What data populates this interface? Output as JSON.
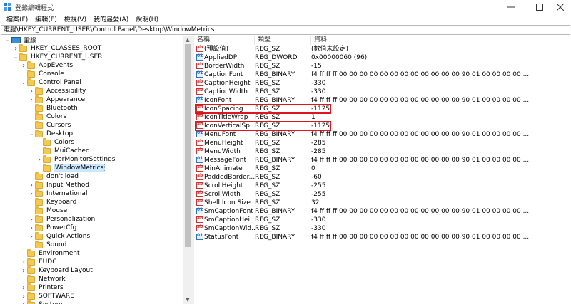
{
  "window": {
    "title": "登錄編輯程式"
  },
  "menu": [
    "檔案(F)",
    "編輯(E)",
    "檢視(V)",
    "我的最愛(A)",
    "說明(H)"
  ],
  "address": "電腦\\HKEY_CURRENT_USER\\Control Panel\\Desktop\\WindowMetrics",
  "tree": [
    {
      "label": "電腦",
      "level": 0,
      "expanded": true,
      "kind": "computer"
    },
    {
      "label": "HKEY_CLASSES_ROOT",
      "level": 1,
      "expanded": false
    },
    {
      "label": "HKEY_CURRENT_USER",
      "level": 1,
      "expanded": true
    },
    {
      "label": "AppEvents",
      "level": 2,
      "expanded": false
    },
    {
      "label": "Console",
      "level": 2,
      "expanded": null
    },
    {
      "label": "Control Panel",
      "level": 2,
      "expanded": true
    },
    {
      "label": "Accessibility",
      "level": 3,
      "expanded": false
    },
    {
      "label": "Appearance",
      "level": 3,
      "expanded": false
    },
    {
      "label": "Bluetooth",
      "level": 3,
      "expanded": null
    },
    {
      "label": "Colors",
      "level": 3,
      "expanded": null
    },
    {
      "label": "Cursors",
      "level": 3,
      "expanded": null
    },
    {
      "label": "Desktop",
      "level": 3,
      "expanded": true
    },
    {
      "label": "Colors",
      "level": 4,
      "expanded": null
    },
    {
      "label": "MuiCached",
      "level": 4,
      "expanded": null
    },
    {
      "label": "PerMonitorSettings",
      "level": 4,
      "expanded": false
    },
    {
      "label": "WindowMetrics",
      "level": 4,
      "expanded": null,
      "selected": true
    },
    {
      "label": "don't load",
      "level": 3,
      "expanded": null
    },
    {
      "label": "Input Method",
      "level": 3,
      "expanded": false
    },
    {
      "label": "International",
      "level": 3,
      "expanded": false
    },
    {
      "label": "Keyboard",
      "level": 3,
      "expanded": null
    },
    {
      "label": "Mouse",
      "level": 3,
      "expanded": null
    },
    {
      "label": "Personalization",
      "level": 3,
      "expanded": false
    },
    {
      "label": "PowerCfg",
      "level": 3,
      "expanded": false
    },
    {
      "label": "Quick Actions",
      "level": 3,
      "expanded": false
    },
    {
      "label": "Sound",
      "level": 3,
      "expanded": null
    },
    {
      "label": "Environment",
      "level": 2,
      "expanded": null
    },
    {
      "label": "EUDC",
      "level": 2,
      "expanded": false
    },
    {
      "label": "Keyboard Layout",
      "level": 2,
      "expanded": false
    },
    {
      "label": "Network",
      "level": 2,
      "expanded": null
    },
    {
      "label": "Printers",
      "level": 2,
      "expanded": false
    },
    {
      "label": "SOFTWARE",
      "level": 2,
      "expanded": false
    },
    {
      "label": "System",
      "level": 2,
      "expanded": false
    }
  ],
  "columns": {
    "name": "名稱",
    "type": "類型",
    "data": "資料"
  },
  "values": [
    {
      "name": "(預設值)",
      "type": "REG_SZ",
      "data": "(數值未設定)",
      "icon": "sz"
    },
    {
      "name": "AppliedDPI",
      "type": "REG_DWORD",
      "data": "0x00000060 (96)",
      "icon": "bin"
    },
    {
      "name": "BorderWidth",
      "type": "REG_SZ",
      "data": "-15",
      "icon": "sz"
    },
    {
      "name": "CaptionFont",
      "type": "REG_BINARY",
      "data": "f4 ff ff ff 00 00 00 00 00 00 00 00 00 00 00 00 90 01 00 00 00 00 ...",
      "icon": "bin"
    },
    {
      "name": "CaptionHeight",
      "type": "REG_SZ",
      "data": "-330",
      "icon": "sz"
    },
    {
      "name": "CaptionWidth",
      "type": "REG_SZ",
      "data": "-330",
      "icon": "sz"
    },
    {
      "name": "IconFont",
      "type": "REG_BINARY",
      "data": "f4 ff ff ff 00 00 00 00 00 00 00 00 00 00 00 00 90 01 00 00 00 00 ...",
      "icon": "bin"
    },
    {
      "name": "IconSpacing",
      "type": "REG_SZ",
      "data": "-1125",
      "icon": "sz",
      "highlight": true
    },
    {
      "name": "IconTitleWrap",
      "type": "REG_SZ",
      "data": "1",
      "icon": "sz"
    },
    {
      "name": "IconVerticalSp...",
      "type": "REG_SZ",
      "data": "-1125",
      "icon": "sz",
      "highlight": true
    },
    {
      "name": "MenuFont",
      "type": "REG_BINARY",
      "data": "f4 ff ff ff 00 00 00 00 00 00 00 00 00 00 00 00 90 01 00 00 00 00 ...",
      "icon": "bin"
    },
    {
      "name": "MenuHeight",
      "type": "REG_SZ",
      "data": "-285",
      "icon": "sz"
    },
    {
      "name": "MenuWidth",
      "type": "REG_SZ",
      "data": "-285",
      "icon": "sz"
    },
    {
      "name": "MessageFont",
      "type": "REG_BINARY",
      "data": "f4 ff ff ff 00 00 00 00 00 00 00 00 00 00 00 00 90 01 00 00 00 00 ...",
      "icon": "bin"
    },
    {
      "name": "MinAnimate",
      "type": "REG_SZ",
      "data": "0",
      "icon": "sz"
    },
    {
      "name": "PaddedBorder...",
      "type": "REG_SZ",
      "data": "-60",
      "icon": "sz"
    },
    {
      "name": "ScrollHeight",
      "type": "REG_SZ",
      "data": "-255",
      "icon": "sz"
    },
    {
      "name": "ScrollWidth",
      "type": "REG_SZ",
      "data": "-255",
      "icon": "sz"
    },
    {
      "name": "Shell Icon Size",
      "type": "REG_SZ",
      "data": "32",
      "icon": "sz"
    },
    {
      "name": "SmCaptionFont",
      "type": "REG_BINARY",
      "data": "f4 ff ff ff 00 00 00 00 00 00 00 00 00 00 00 00 90 01 00 00 00 00 ...",
      "icon": "bin"
    },
    {
      "name": "SmCaptionHei...",
      "type": "REG_SZ",
      "data": "-330",
      "icon": "sz"
    },
    {
      "name": "SmCaptionWid...",
      "type": "REG_SZ",
      "data": "-330",
      "icon": "sz"
    },
    {
      "name": "StatusFont",
      "type": "REG_BINARY",
      "data": "f4 ff ff ff 00 00 00 00 00 00 00 00 00 00 00 00 90 01 00 00 00 00 ...",
      "icon": "bin"
    }
  ],
  "colors": {
    "highlight": "#e0141f",
    "selection": "#cce8ff",
    "folder": "#f3c94f"
  }
}
